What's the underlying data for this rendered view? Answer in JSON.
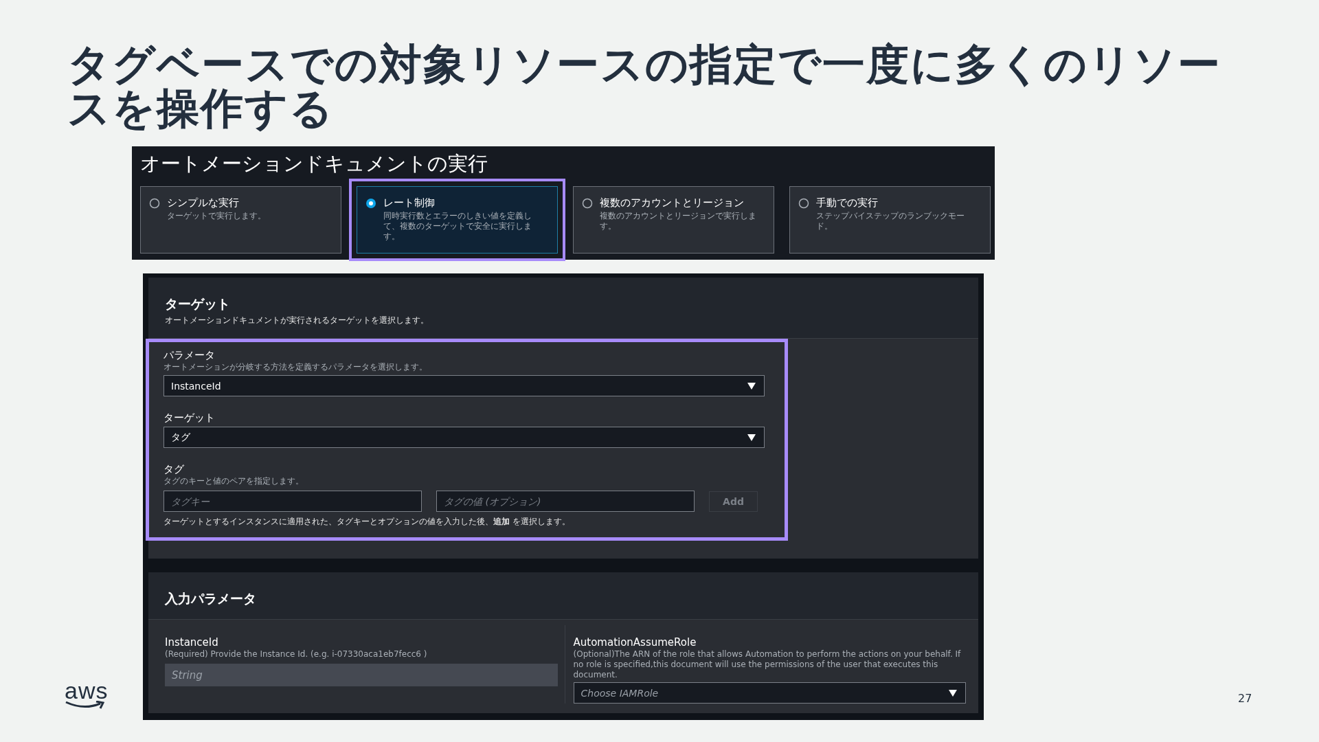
{
  "slide": {
    "title": "タグベースでの対象リソースの指定で一度に多くのリソースを操作する",
    "logo": "aws",
    "page_number": "27"
  },
  "execution_panel": {
    "title": "オートメーションドキュメントの実行",
    "options": [
      {
        "label": "シンプルな実行",
        "description": "ターゲットで実行します。",
        "selected": false
      },
      {
        "label": "レート制御",
        "description": "同時実行数とエラーのしきい値を定義して、複数のターゲットで安全に実行します。",
        "selected": true
      },
      {
        "label": "複数のアカウントとリージョン",
        "description": "複数のアカウントとリージョンで実行します。",
        "selected": false
      },
      {
        "label": "手動での実行",
        "description": "ステップバイステップのランブックモード。",
        "selected": false
      }
    ]
  },
  "target_section": {
    "title": "ターゲット",
    "description": "オートメーションドキュメントが実行されるターゲットを選択します。",
    "parameter": {
      "label": "パラメータ",
      "hint": "オートメーションが分岐する方法を定義するパラメータを選択します。",
      "value": "InstanceId"
    },
    "target": {
      "label": "ターゲット",
      "value": "タグ"
    },
    "tags": {
      "label": "タグ",
      "hint": "タグのキーと値のペアを指定します。",
      "key_placeholder": "タグキー",
      "value_placeholder": "タグの値 (オプション)",
      "add_button": "Add",
      "note": "ターゲットとするインスタンスに適用された、タグキーとオプションの値を入力した後、**追加** を選択します。"
    }
  },
  "input_parameters": {
    "title": "入力パラメータ",
    "fields": [
      {
        "kind": "text",
        "label": "InstanceId",
        "hint": "(Required) Provide the Instance Id. (e.g. i-07330aca1eb7fecc6 )",
        "placeholder": "String"
      },
      {
        "kind": "select",
        "label": "AutomationAssumeRole",
        "hint": "(Optional)The ARN of the role that allows Automation to perform the actions on your behalf. If no role is specified,this document will use the permissions of the user that executes this document.",
        "placeholder": "Choose IAMRole"
      }
    ]
  }
}
